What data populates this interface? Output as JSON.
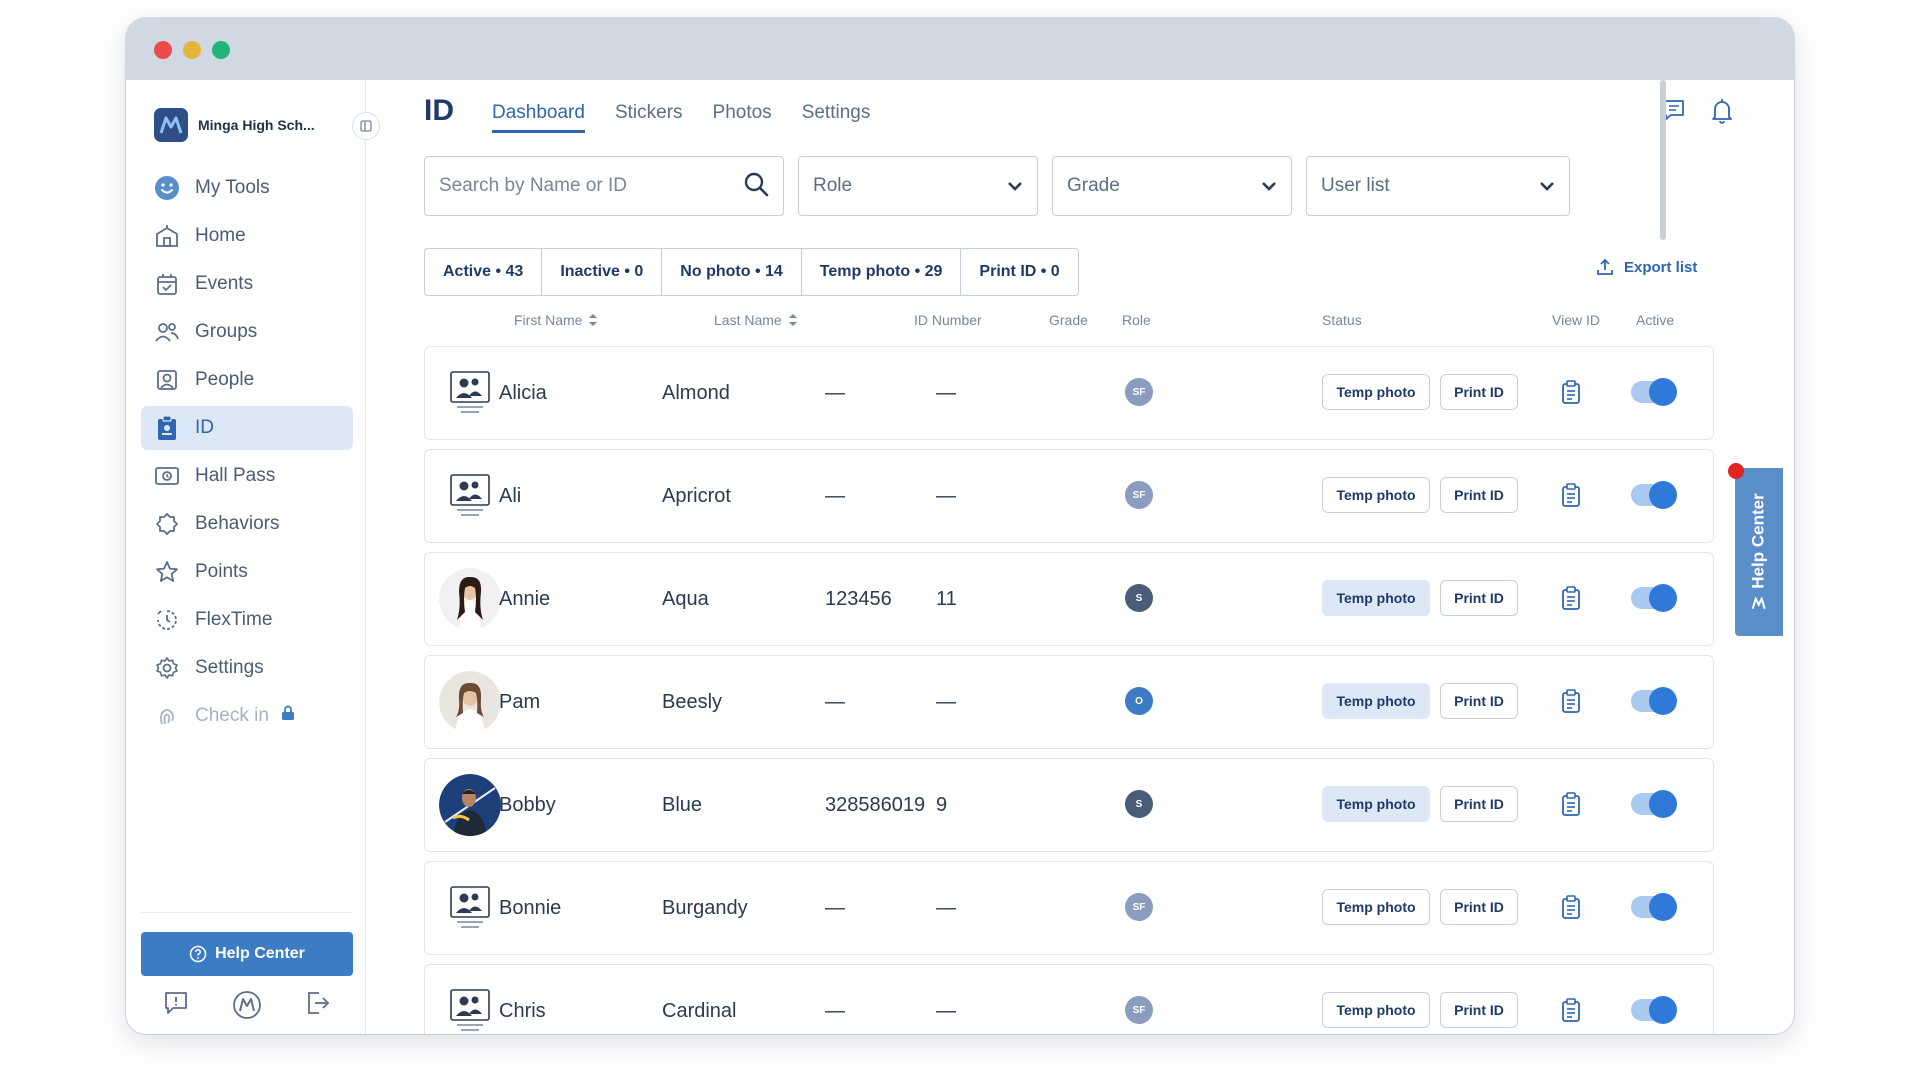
{
  "school": {
    "name": "Minga High Sch..."
  },
  "sidebar": {
    "items": [
      {
        "label": "My Tools",
        "icon": "smiley-icon",
        "active": false
      },
      {
        "label": "Home",
        "icon": "school-icon",
        "active": false
      },
      {
        "label": "Events",
        "icon": "calendar-icon",
        "active": false
      },
      {
        "label": "Groups",
        "icon": "groups-icon",
        "active": false
      },
      {
        "label": "People",
        "icon": "person-badge-icon",
        "active": false
      },
      {
        "label": "ID",
        "icon": "id-badge-icon",
        "active": true
      },
      {
        "label": "Hall Pass",
        "icon": "hall-pass-icon",
        "active": false
      },
      {
        "label": "Behaviors",
        "icon": "behaviors-icon",
        "active": false
      },
      {
        "label": "Points",
        "icon": "star-icon",
        "active": false
      },
      {
        "label": "FlexTime",
        "icon": "flextime-icon",
        "active": false
      },
      {
        "label": "Settings",
        "icon": "gear-icon",
        "active": false
      },
      {
        "label": "Check in",
        "icon": "fingerprint-icon",
        "active": false,
        "locked": true
      }
    ],
    "help_label": "Help Center"
  },
  "header": {
    "title": "ID",
    "tabs": [
      "Dashboard",
      "Stickers",
      "Photos",
      "Settings"
    ],
    "active_tab": "Dashboard"
  },
  "filters": {
    "search_placeholder": "Search by Name or ID",
    "role": "Role",
    "grade": "Grade",
    "user_list": "User list"
  },
  "status_tabs": [
    "Active • 43",
    "Inactive • 0",
    "No photo • 14",
    "Temp photo • 29",
    "Print ID • 0"
  ],
  "export_label": "Export list",
  "columns": {
    "first_name": "First Name",
    "last_name": "Last Name",
    "id_number": "ID Number",
    "grade": "Grade",
    "role": "Role",
    "status": "Status",
    "view_id": "View ID",
    "active": "Active"
  },
  "buttons": {
    "temp_photo": "Temp photo",
    "print_id": "Print ID"
  },
  "rows": [
    {
      "first": "Alicia",
      "last": "Almond",
      "id": "—",
      "grade": "—",
      "role": "SF",
      "photo": "placeholder",
      "temp_filled": false
    },
    {
      "first": "Ali",
      "last": "Apricrot",
      "id": "—",
      "grade": "—",
      "role": "SF",
      "photo": "placeholder",
      "temp_filled": false
    },
    {
      "first": "Annie",
      "last": "Aqua",
      "id": "123456",
      "grade": "11",
      "role": "S",
      "photo": "photo",
      "temp_filled": true
    },
    {
      "first": "Pam",
      "last": "Beesly",
      "id": "—",
      "grade": "—",
      "role": "O",
      "photo": "photo",
      "temp_filled": true
    },
    {
      "first": "Bobby",
      "last": "Blue",
      "id": "328586019",
      "grade": "9",
      "role": "S",
      "photo": "photo",
      "temp_filled": true
    },
    {
      "first": "Bonnie",
      "last": "Burgandy",
      "id": "—",
      "grade": "—",
      "role": "SF",
      "photo": "placeholder",
      "temp_filled": false
    },
    {
      "first": "Chris",
      "last": "Cardinal",
      "id": "—",
      "grade": "—",
      "role": "SF",
      "photo": "placeholder",
      "temp_filled": false
    }
  ],
  "colors": {
    "accent": "#2f66ae",
    "role_sf": "#8a9cc0",
    "role_s": "#4a5d78",
    "role_o": "#3d7cc4",
    "toggle_on": "#2f7ad8"
  },
  "floating_help": "Help Center"
}
